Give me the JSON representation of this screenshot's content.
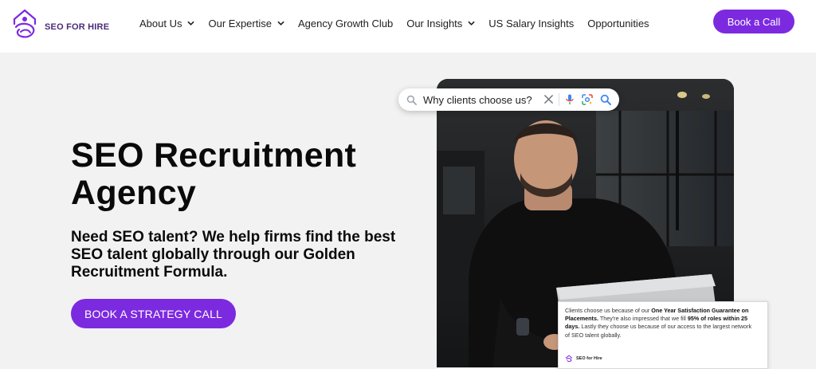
{
  "header": {
    "logo_text": "SEO FOR HIRE",
    "nav": [
      {
        "label": "About Us",
        "dropdown": true
      },
      {
        "label": "Our Expertise",
        "dropdown": true
      },
      {
        "label": "Agency Growth Club",
        "dropdown": false
      },
      {
        "label": "Our Insights",
        "dropdown": true
      },
      {
        "label": "US Salary Insights",
        "dropdown": false
      },
      {
        "label": "Opportunities",
        "dropdown": false
      }
    ],
    "book_call_label": "Book a Call"
  },
  "hero": {
    "title_line1": "SEO Recruitment",
    "title_line2": "Agency",
    "subtitle": "Need SEO talent? We help firms find the best SEO talent globally through our Golden Recruitment Formula.",
    "cta_label": "BOOK A STRATEGY CALL"
  },
  "search_overlay": {
    "query": "Why clients choose us?"
  },
  "review_card": {
    "part1": "Clients choose us because of our ",
    "bold1": "One Year Satisfaction Guarantee on Placements.",
    "part2": " They're also impressed that we fill ",
    "bold2": "95% of roles within 25 days.",
    "part3": " Lastly they choose us because of our access to the largest network of SEO talent globally.",
    "source_name": "SEO for Hire"
  },
  "colors": {
    "brand_purple": "#7c2ae0",
    "logo_purple": "#4a2a7a",
    "background": "#f2f2f3"
  },
  "icons": [
    "logo-mark",
    "chevron-down-icon",
    "search-icon",
    "clear-icon",
    "mic-icon",
    "lens-icon"
  ]
}
